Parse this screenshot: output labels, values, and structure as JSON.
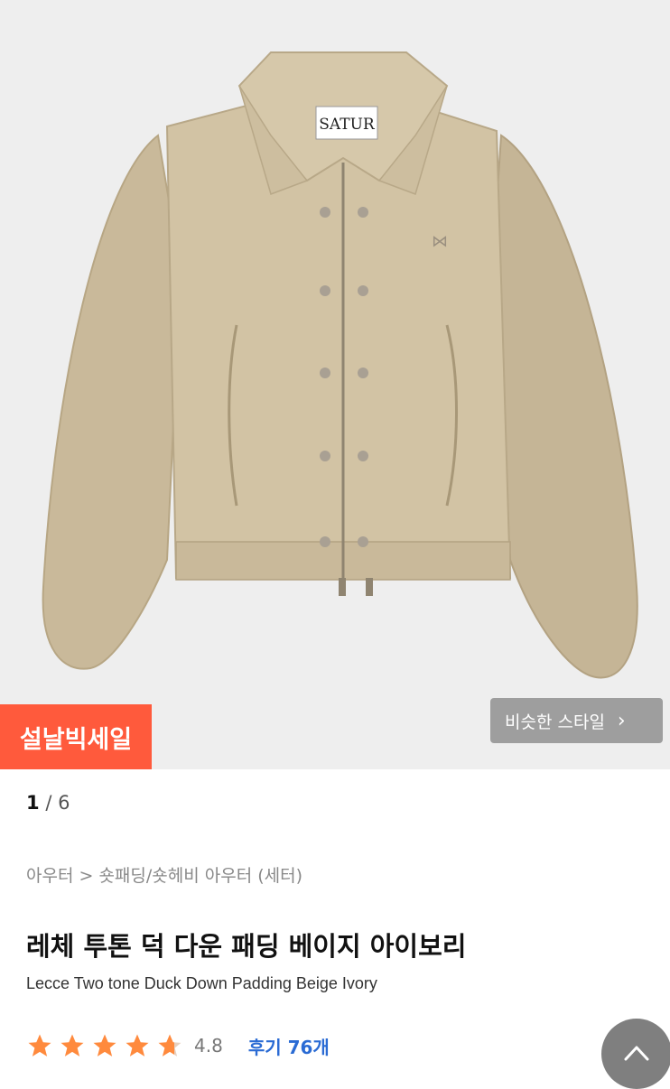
{
  "hero": {
    "image_alt": "Beige short padded jacket",
    "label_text": "SATUR",
    "sale_badge": "설날빅세일",
    "similar_style_label": "비슷한 스타일",
    "similar_style_chevron": "›"
  },
  "gallery": {
    "current": "1",
    "separator": "/",
    "total": "6"
  },
  "product": {
    "breadcrumb": "아우터 > 숏패딩/숏헤비 아우터 (세터)",
    "title_ko": "레체 투톤 덕 다운 패딩 베이지 아이보리",
    "title_en": "Lecce Two tone Duck Down Padding Beige Ivory",
    "rating": "4.8",
    "review_label": "후기 76개",
    "stars": [
      1,
      1,
      1,
      1,
      0.5
    ]
  },
  "colors": {
    "accent_orange": "#ff5a3c",
    "star_color": "#ff8a3d",
    "review_link": "#2a6bd4"
  },
  "icons": {
    "scroll_top": "chevron-up-icon",
    "star": "star-icon"
  }
}
